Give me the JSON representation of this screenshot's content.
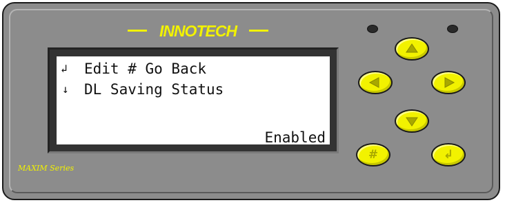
{
  "device": {
    "brand": "INNOTECH",
    "series": "MAXIM Series",
    "colors": {
      "panel": "#8c8c8c",
      "accent_yellow": "#f2f200",
      "lcd_background": "#ffffff",
      "lcd_text": "#111111"
    }
  },
  "lcd": {
    "rows": [
      {
        "icon": "↲",
        "icon_name": "enter-arrow-icon",
        "text": "Edit # Go Back"
      },
      {
        "icon": "↓",
        "icon_name": "down-arrow-icon",
        "text": "DL Saving Status"
      },
      {
        "icon": "",
        "text": ""
      },
      {
        "icon": "",
        "text": "Enabled"
      }
    ]
  },
  "keypad": {
    "up": {
      "icon": "up-arrow-icon"
    },
    "left": {
      "icon": "left-arrow-icon"
    },
    "right": {
      "icon": "right-arrow-icon"
    },
    "down": {
      "icon": "down-arrow-icon"
    },
    "hash": {
      "label": "#"
    },
    "enter": {
      "label": "↲",
      "icon": "enter-icon"
    }
  },
  "indicators": [
    {
      "name": "led-left",
      "state": "off"
    },
    {
      "name": "led-right",
      "state": "off"
    }
  ]
}
